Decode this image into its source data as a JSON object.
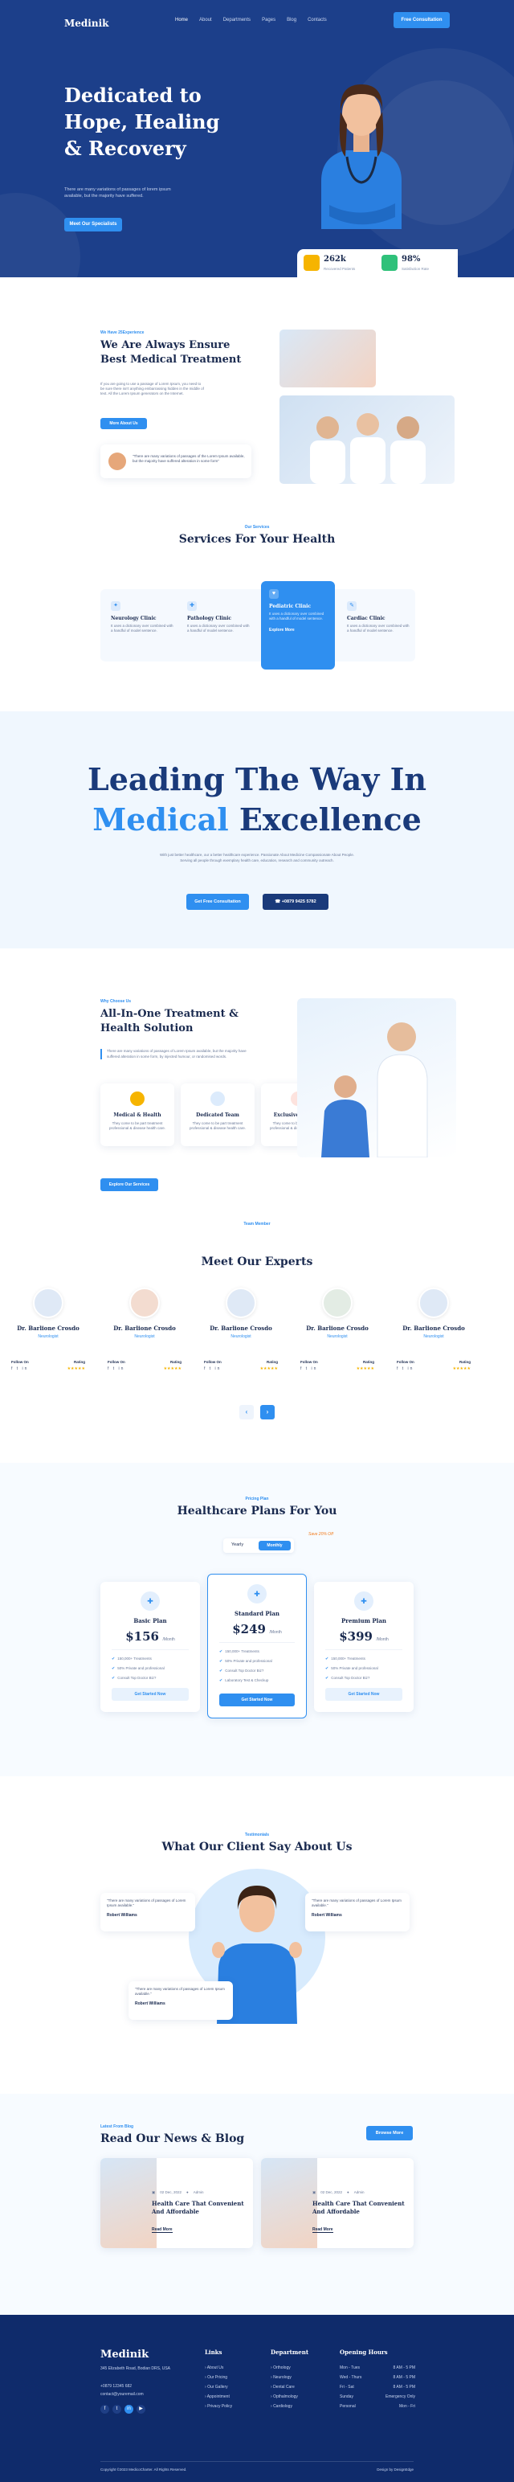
{
  "brand": "Medinik",
  "nav": {
    "items": [
      "Home",
      "About",
      "Departments",
      "Pages",
      "Blog",
      "Contacts"
    ],
    "cta": "Free Consultation"
  },
  "hero": {
    "title_line1": "Dedicated to",
    "title_line2": "Hope, Healing",
    "title_line3": "& Recovery",
    "subtitle": "There are many variations of passages of lorem ipsum available, but the majority have suffered.",
    "button": "Meet Our Specialists",
    "stat1_value": "262k",
    "stat1_label": "Recovered Patients",
    "stat2_value": "98%",
    "stat2_label": "Satisfaction Rate"
  },
  "about": {
    "kicker": "We Have 25Experience",
    "title_line1": "We Are Always Ensure",
    "title_line2": "Best Medical Treatment",
    "text": "If you are going to use a passage of Lorem Ipsum, you need to be sure there isn't anything embarrassing hidden in the middle of text. All the Lorem Ipsum generators on the Internet.",
    "button": "More About Us",
    "quote": "\"There are many variations of passages of the Lorem Ipsum available, but the majority have suffered alteration in some form\""
  },
  "services": {
    "kicker": "Our Services",
    "title": "Services For Your Health",
    "items": [
      {
        "title": "Neurology Clinic",
        "text": "It uses a dictionary over combined with a handful of model sentence."
      },
      {
        "title": "Pathology Clinic",
        "text": "It uses a dictionary over combined with a handful of model sentence."
      },
      {
        "title": "Pediatric Clinic",
        "text": "It uses a dictionary over combined with a handful of model sentence.",
        "link": "Explore More"
      },
      {
        "title": "Cardiac Clinic",
        "text": "It uses a dictionary over combined with a handful of model sentence."
      }
    ]
  },
  "leading": {
    "line1": "Leading The Way In",
    "line2_accent": "Medical",
    "line2_rest": "Excellence",
    "text": "With just better healthcare, our a better healthcare experience. Passionate About Medicine Compassionate About People. Serving all people through exemplary health care, education, research and community outreach.",
    "button1": "Get Free Consultation",
    "button2": "+0879 9425 5782"
  },
  "why": {
    "kicker": "Why Choose Us",
    "title_line1": "All-In-One Treatment &",
    "title_line2": "Health Solution",
    "text": "There are many variations of passages of Lorem Ipsum available, but the majority have suffered alteration in some form, by injected humour, or randomised words.",
    "features": [
      {
        "title": "Medical & Health",
        "text": "They come to be part treatment professional & disease health care."
      },
      {
        "title": "Dedicated Team",
        "text": "They come to be part treatment professional & disease health care."
      },
      {
        "title": "Exclusive Support",
        "text": "They come to be part treatment professional & disease health care."
      }
    ],
    "button": "Explore Our Services"
  },
  "experts": {
    "kicker": "Team Member",
    "title": "Meet Our Experts",
    "follow_label": "Follow On",
    "rating_label": "Rating",
    "doctors": [
      {
        "name": "Dr. Barlione Crosdo",
        "role": "Neurologist"
      },
      {
        "name": "Dr. Barlione Crosdo",
        "role": "Neurologist"
      },
      {
        "name": "Dr. Barlione Crosdo",
        "role": "Neurologist"
      },
      {
        "name": "Dr. Barlione Crosdo",
        "role": "Neurologist"
      },
      {
        "name": "Dr. Barlione Crosdo",
        "role": "Neurologist"
      }
    ]
  },
  "pricing": {
    "kicker": "Pricing Plan",
    "title": "Healthcare Plans For You",
    "toggle_yearly": "Yearly",
    "toggle_monthly": "Monthly",
    "save_note": "Save 20% Off",
    "plans": [
      {
        "name": "Basic Plan",
        "price": "$156",
        "per": "/Month",
        "features": [
          "150,000+ Treatments",
          "50% Private and professional",
          "Consult Top Doctor Biz?"
        ],
        "button": "Get Started Now"
      },
      {
        "name": "Standard Plan",
        "price": "$249",
        "per": "/Month",
        "features": [
          "150,000+ Treatments",
          "50% Private and professional",
          "Consult Top Doctor Biz?",
          "Laboratory Test & Checkup"
        ],
        "button": "Get Started Now"
      },
      {
        "name": "Premium Plan",
        "price": "$399",
        "per": "/Month",
        "features": [
          "150,000+ Treatments",
          "50% Private and professional",
          "Consult Top Doctor Biz?"
        ],
        "button": "Get Started Now"
      }
    ]
  },
  "testimonials": {
    "kicker": "Testimonials",
    "title": "What Our Client Say About Us",
    "items": [
      {
        "quote": "\"There are many variations of passages of Lorem Ipsum available.\"",
        "name": "Robert Williams"
      },
      {
        "quote": "\"There are many variations of passages of Lorem Ipsum available.\"",
        "name": "Robert Williams"
      },
      {
        "quote": "\"There are many variations of passages of Lorem Ipsum available.\"",
        "name": "Robert Williams"
      }
    ]
  },
  "blog": {
    "kicker": "Latest From Blog",
    "title": "Read Our News & Blog",
    "button": "Browse More",
    "posts": [
      {
        "date": "02 Dec, 2022",
        "author": "Admin",
        "title": "Health Care That Convenient And Affordable",
        "link": "Read More"
      },
      {
        "date": "02 Dec, 2022",
        "author": "Admin",
        "title": "Health Care That Convenient And Affordable",
        "link": "Read More"
      }
    ]
  },
  "footer": {
    "address": "345 Elizabeth Road, Bodian DRS, USA",
    "phone": "+0879 12345 682",
    "email": "contact@youremail.com",
    "links_title": "Links",
    "links": [
      "About Us",
      "Our Pricing",
      "Our Gallery",
      "Appointment",
      "Privacy Policy"
    ],
    "dept_title": "Department",
    "departments": [
      "Orthology",
      "Neurology",
      "Dental Care",
      "Opthalmology",
      "Cardiology"
    ],
    "hours_title": "Opening Hours",
    "hours": [
      {
        "day": "Mon - Tues",
        "time": "8 AM - 5 PM"
      },
      {
        "day": "Wed - Thurs",
        "time": "8 AM - 5 PM"
      },
      {
        "day": "Fri - Sat",
        "time": "8 AM - 5 PM"
      },
      {
        "day": "Sunday",
        "time": "Emergency Only"
      },
      {
        "day": "Personal",
        "time": "Mon - Fri"
      }
    ],
    "copyright": "Copyright ©2023 MedicoCharter. All Rights Reserved.",
    "credit": "Design by DesignEdge"
  },
  "colors": {
    "primary": "#2f8ff0",
    "navy": "#1c3f8a",
    "dark": "#1a2a4f",
    "footer": "#0f2b6b"
  }
}
